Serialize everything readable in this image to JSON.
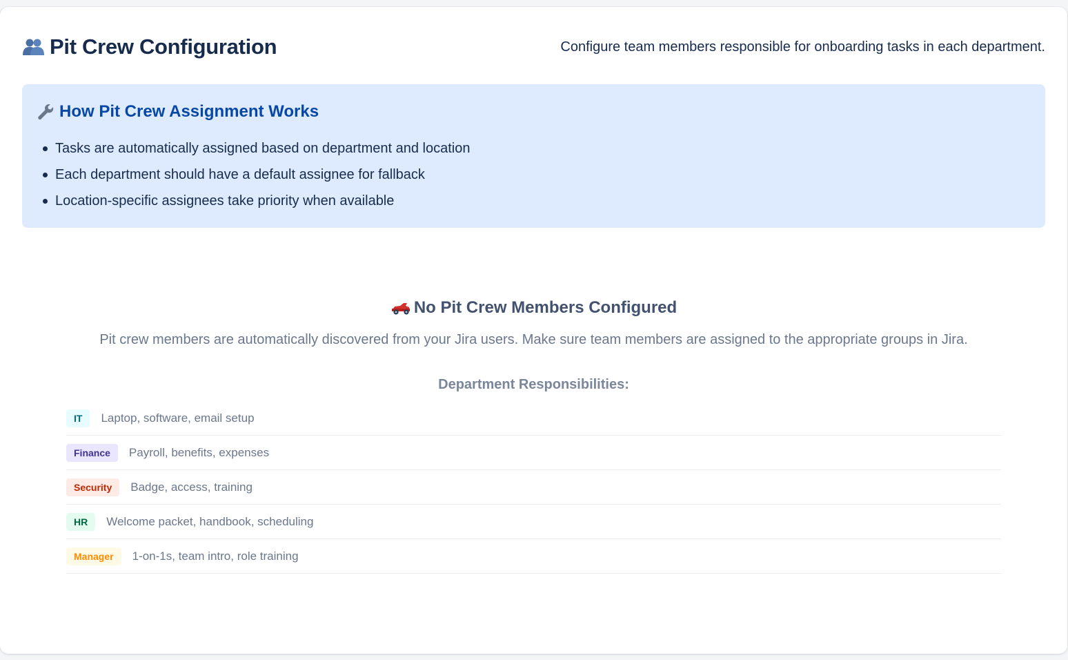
{
  "header": {
    "title": "Pit Crew Configuration",
    "subtitle": "Configure team members responsible for onboarding tasks in each department."
  },
  "info": {
    "title": "How Pit Crew Assignment Works",
    "items": [
      "Tasks are automatically assigned based on department and location",
      "Each department should have a default assignee for fallback",
      "Location-specific assignees take priority when available"
    ]
  },
  "empty_state": {
    "title": "No Pit Crew Members Configured",
    "description": "Pit crew members are automatically discovered from your Jira users. Make sure team members are assigned to the appropriate groups in Jira.",
    "responsibilities_title": "Department Responsibilities:",
    "departments": [
      {
        "name": "IT",
        "description": "Laptop, software, email setup",
        "bg": "#e6fcff",
        "fg": "#00667a"
      },
      {
        "name": "Finance",
        "description": "Payroll, benefits, expenses",
        "bg": "#eae6ff",
        "fg": "#403294"
      },
      {
        "name": "Security",
        "description": "Badge, access, training",
        "bg": "#ffebe6",
        "fg": "#bf2600"
      },
      {
        "name": "HR",
        "description": "Welcome packet, handbook, scheduling",
        "bg": "#e3fcef",
        "fg": "#006644"
      },
      {
        "name": "Manager",
        "description": "1-on-1s, team intro, role training",
        "bg": "#fffae6",
        "fg": "#ff8b00"
      }
    ]
  },
  "colors": {
    "info_bg": "#deebff",
    "info_title": "#0747a6",
    "text_primary": "#172b4d",
    "text_muted": "#6b778c"
  },
  "icons": {
    "title": "people-icon",
    "info": "wrench-icon",
    "empty": "race-car-icon"
  }
}
